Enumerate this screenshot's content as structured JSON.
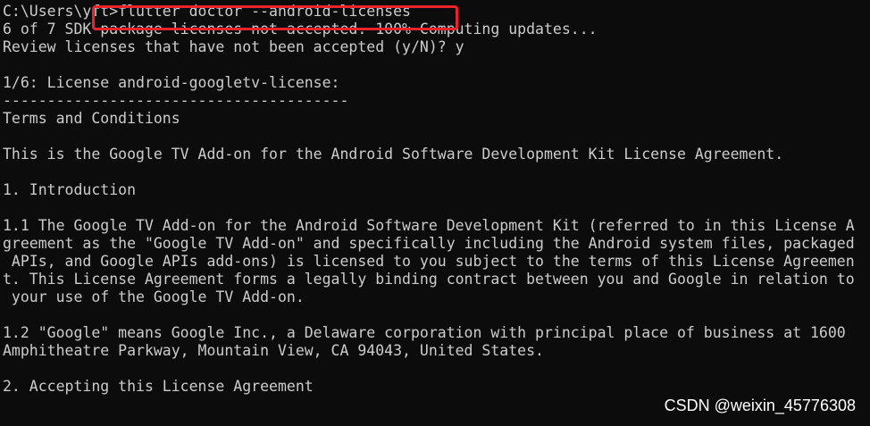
{
  "terminal": {
    "lines": [
      "C:\\Users\\yft>flutter doctor --android-licenses",
      "6 of 7 SDK package licenses not accepted. 100% Computing updates...",
      "Review licenses that have not been accepted (y/N)? y",
      "",
      "1/6: License android-googletv-license:",
      "---------------------------------------",
      "Terms and Conditions",
      "",
      "This is the Google TV Add-on for the Android Software Development Kit License Agreement.",
      "",
      "1. Introduction",
      "",
      "1.1 The Google TV Add-on for the Android Software Development Kit (referred to in this License A",
      "greement as the \"Google TV Add-on\" and specifically including the Android system files, packaged",
      " APIs, and Google APIs add-ons) is licensed to you subject to the terms of this License Agreemen",
      "t. This License Agreement forms a legally binding contract between you and Google in relation to",
      " your use of the Google TV Add-on.",
      "",
      "1.2 \"Google\" means Google Inc., a Delaware corporation with principal place of business at 1600",
      "Amphitheatre Parkway, Mountain View, CA 94043, United States.",
      "",
      "2. Accepting this License Agreement"
    ]
  },
  "watermark": {
    "text": "CSDN @weixin_45776308"
  }
}
